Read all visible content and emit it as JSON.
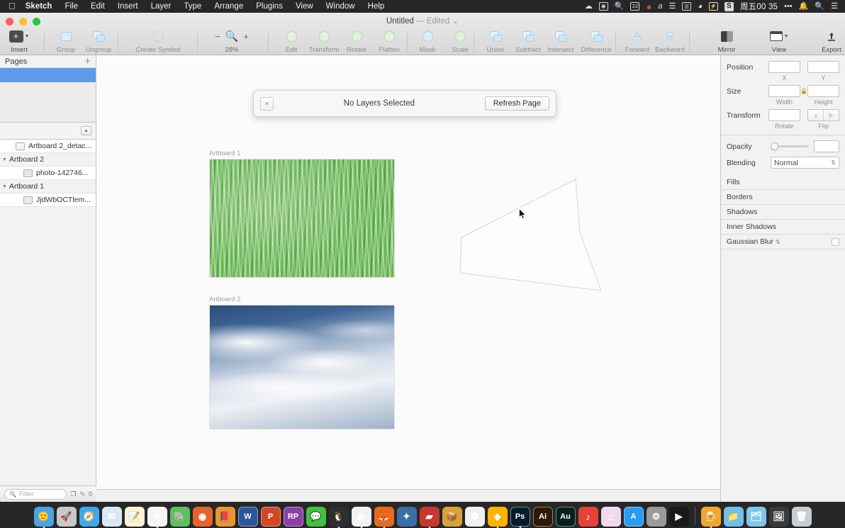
{
  "menubar": {
    "apple": "apple-logo",
    "items": [
      "Sketch",
      "File",
      "Edit",
      "Insert",
      "Layer",
      "Type",
      "Arrange",
      "Plugins",
      "View",
      "Window",
      "Help"
    ],
    "status_icons": [
      "cloud-icon",
      "screenshot-icon",
      "magnifier-stat-icon",
      "calendar-icon",
      "record-dot-icon",
      "alpha-input-icon",
      "airdrop-icon",
      "battery-bar-icon",
      "wifi-icon",
      "battery-charge-icon",
      "sogou-icon"
    ],
    "clock": "周五00 35",
    "overflow": "•••",
    "bell": "bell-icon",
    "search": "spotlight-icon",
    "notification_center": "notification-center-icon"
  },
  "window": {
    "title": "Untitled",
    "dash": "—",
    "state": "Edited",
    "chevron": "⌄"
  },
  "toolbar": {
    "insert": {
      "label": "Insert",
      "icon": "plus-square-icon"
    },
    "group": {
      "label": "Group",
      "icon": "group-icon"
    },
    "ungroup": {
      "label": "Ungroup",
      "icon": "ungroup-icon"
    },
    "create_symbol": {
      "label": "Create Symbol",
      "icon": "symbol-icon"
    },
    "zoom": {
      "minus": "−",
      "plus": "+",
      "magnifier": "magnifier-icon",
      "value": "28%"
    },
    "edit": {
      "label": "Edit",
      "icon": "edit-icon"
    },
    "transform": {
      "label": "Transform",
      "icon": "transform-icon"
    },
    "rotate": {
      "label": "Rotate",
      "icon": "rotate-icon"
    },
    "flatten": {
      "label": "Flatten",
      "icon": "flatten-icon"
    },
    "mask": {
      "label": "Mask",
      "icon": "mask-icon"
    },
    "scale": {
      "label": "Scale",
      "icon": "scale-icon"
    },
    "union": {
      "label": "Union",
      "icon": "union-icon"
    },
    "subtract": {
      "label": "Subtract",
      "icon": "subtract-icon"
    },
    "intersect": {
      "label": "Intersect",
      "icon": "intersect-icon"
    },
    "difference": {
      "label": "Difference",
      "icon": "difference-icon"
    },
    "forward": {
      "label": "Forward",
      "icon": "forward-icon"
    },
    "backward": {
      "label": "Backward",
      "icon": "backward-icon"
    },
    "mirror": {
      "label": "Mirror",
      "icon": "mirror-icon"
    },
    "view": {
      "label": "View",
      "icon": "view-icon"
    },
    "export": {
      "label": "Export",
      "icon": "export-icon"
    }
  },
  "sidebar": {
    "pages_title": "Pages",
    "add_page": "+",
    "pages": [
      {
        "name": "",
        "selected": true
      }
    ],
    "collapse_button": "collapse-icon",
    "layers": [
      {
        "name": "Artboard 2_detac...",
        "icon": "folder-icon",
        "indent": 2,
        "disclosure": ""
      },
      {
        "name": "Artboard 2",
        "icon": "",
        "indent": 0,
        "disclosure": "▼"
      },
      {
        "name": "photo-142746...",
        "icon": "image-icon",
        "indent": 3,
        "disclosure": ""
      },
      {
        "name": "Artboard 1",
        "icon": "",
        "indent": 0,
        "disclosure": "▼"
      },
      {
        "name": "JjdWbOCTlem...",
        "icon": "image-icon",
        "indent": 3,
        "disclosure": ""
      }
    ],
    "filter_placeholder": "Filter",
    "filter_value": "",
    "foot_icons": [
      "duplicate-icon",
      "pencil-icon"
    ],
    "foot_count": "0"
  },
  "banner": {
    "close": "×",
    "message": "No Layers Selected",
    "action": "Refresh Page"
  },
  "canvas": {
    "artboards": [
      {
        "label": "Artboard 1",
        "art": "grass"
      },
      {
        "label": "Artboard 2",
        "art": "sky"
      }
    ],
    "shape_name": "rotated-quadrilateral",
    "cursor": "arrow-cursor"
  },
  "inspector": {
    "position": {
      "label": "Position",
      "x": "",
      "y": "",
      "x_sub": "X",
      "y_sub": "Y"
    },
    "size": {
      "label": "Size",
      "width": "",
      "height": "",
      "width_sub": "Width",
      "height_sub": "Height",
      "lock": "lock-icon"
    },
    "transform": {
      "label": "Transform",
      "rotate": "",
      "rotate_sub": "Rotate",
      "flip_sub": "Flip",
      "flip_h": "flip-horizontal-icon",
      "flip_v": "flip-vertical-icon"
    },
    "opacity": {
      "label": "Opacity",
      "value": ""
    },
    "blending": {
      "label": "Blending",
      "value": "Normal",
      "stepper": "⇅"
    },
    "sections": [
      {
        "label": "Fills",
        "checkbox": false
      },
      {
        "label": "Borders",
        "checkbox": false
      },
      {
        "label": "Shadows",
        "checkbox": false
      },
      {
        "label": "Inner Shadows",
        "checkbox": false
      },
      {
        "label": "Gaussian Blur",
        "checkbox": true,
        "stepper": "⇅"
      }
    ]
  },
  "dock": {
    "items": [
      {
        "name": "finder",
        "glyph": "🙂",
        "bg": "#4aa3e8",
        "running": true
      },
      {
        "name": "launchpad",
        "glyph": "🚀",
        "bg": "#c8c8c8",
        "running": false
      },
      {
        "name": "safari",
        "glyph": "🧭",
        "bg": "#3aa9f0",
        "running": false
      },
      {
        "name": "mail",
        "glyph": "✉",
        "bg": "#d8e8f5",
        "running": false
      },
      {
        "name": "notes",
        "glyph": "📝",
        "bg": "#fdf3d0",
        "running": false
      },
      {
        "name": "slack",
        "glyph": "S",
        "bg": "#f5f5f5",
        "running": true
      },
      {
        "name": "evernote",
        "glyph": "🐘",
        "bg": "#5fbf5f",
        "running": false
      },
      {
        "name": "cc-cleaner",
        "glyph": "◉",
        "bg": "#e8622d",
        "running": false
      },
      {
        "name": "reader",
        "glyph": "📕",
        "bg": "#e8962d",
        "running": false
      },
      {
        "name": "word",
        "glyph": "W",
        "bg": "#2b579a",
        "running": false
      },
      {
        "name": "powerpoint",
        "glyph": "P",
        "bg": "#d24726",
        "running": false
      },
      {
        "name": "rp-app",
        "glyph": "RP",
        "bg": "#8b3fa8",
        "running": false
      },
      {
        "name": "wechat",
        "glyph": "💬",
        "bg": "#3ec43e",
        "running": false
      },
      {
        "name": "qq",
        "glyph": "🐧",
        "bg": "#2f2f2f",
        "running": true
      },
      {
        "name": "chrome",
        "glyph": "◍",
        "bg": "#f2f2f2",
        "running": true
      },
      {
        "name": "firefox",
        "glyph": "🦊",
        "bg": "#e86a1c",
        "running": true
      },
      {
        "name": "sublime",
        "glyph": "✦",
        "bg": "#3a6ea8",
        "running": false
      },
      {
        "name": "zeppelin",
        "glyph": "▰",
        "bg": "#c8392d",
        "running": true
      },
      {
        "name": "keka",
        "glyph": "📦",
        "bg": "#d8a23a",
        "running": false
      },
      {
        "name": "photos",
        "glyph": "❁",
        "bg": "#f0f0f0",
        "running": false
      },
      {
        "name": "sketch",
        "glyph": "◆",
        "bg": "#fdb300",
        "running": true
      },
      {
        "name": "photoshop",
        "glyph": "Ps",
        "bg": "#031c2e",
        "running": true
      },
      {
        "name": "illustrator",
        "glyph": "Ai",
        "bg": "#2e1a03",
        "running": false
      },
      {
        "name": "audition",
        "glyph": "Au",
        "bg": "#03201c",
        "running": false
      },
      {
        "name": "netease-music",
        "glyph": "♪",
        "bg": "#e8413a",
        "running": false
      },
      {
        "name": "music",
        "glyph": "♫",
        "bg": "#f2d8ef",
        "running": false
      },
      {
        "name": "app-store",
        "glyph": "A",
        "bg": "#2b9bf0",
        "running": false
      },
      {
        "name": "system-preferences",
        "glyph": "⚙",
        "bg": "#9a9a9a",
        "running": false
      },
      {
        "name": "terminal",
        "glyph": "▶",
        "bg": "#1a1a1a",
        "running": false
      },
      {
        "name": "cheers",
        "glyph": "🍺",
        "bg": "#f0a830",
        "running": true
      },
      {
        "name": "documents-folder",
        "glyph": "📁",
        "bg": "#6fc0ec",
        "running": false
      },
      {
        "name": "downloads-folder",
        "glyph": "🗂",
        "bg": "#7ec8ea",
        "running": false
      },
      {
        "name": "pictures-folder",
        "glyph": "🖼",
        "bg": "#3a3a3a",
        "running": false
      },
      {
        "name": "trash",
        "glyph": "🗑",
        "bg": "#c8cdd2",
        "running": false
      }
    ],
    "separator_after_index": 28
  }
}
